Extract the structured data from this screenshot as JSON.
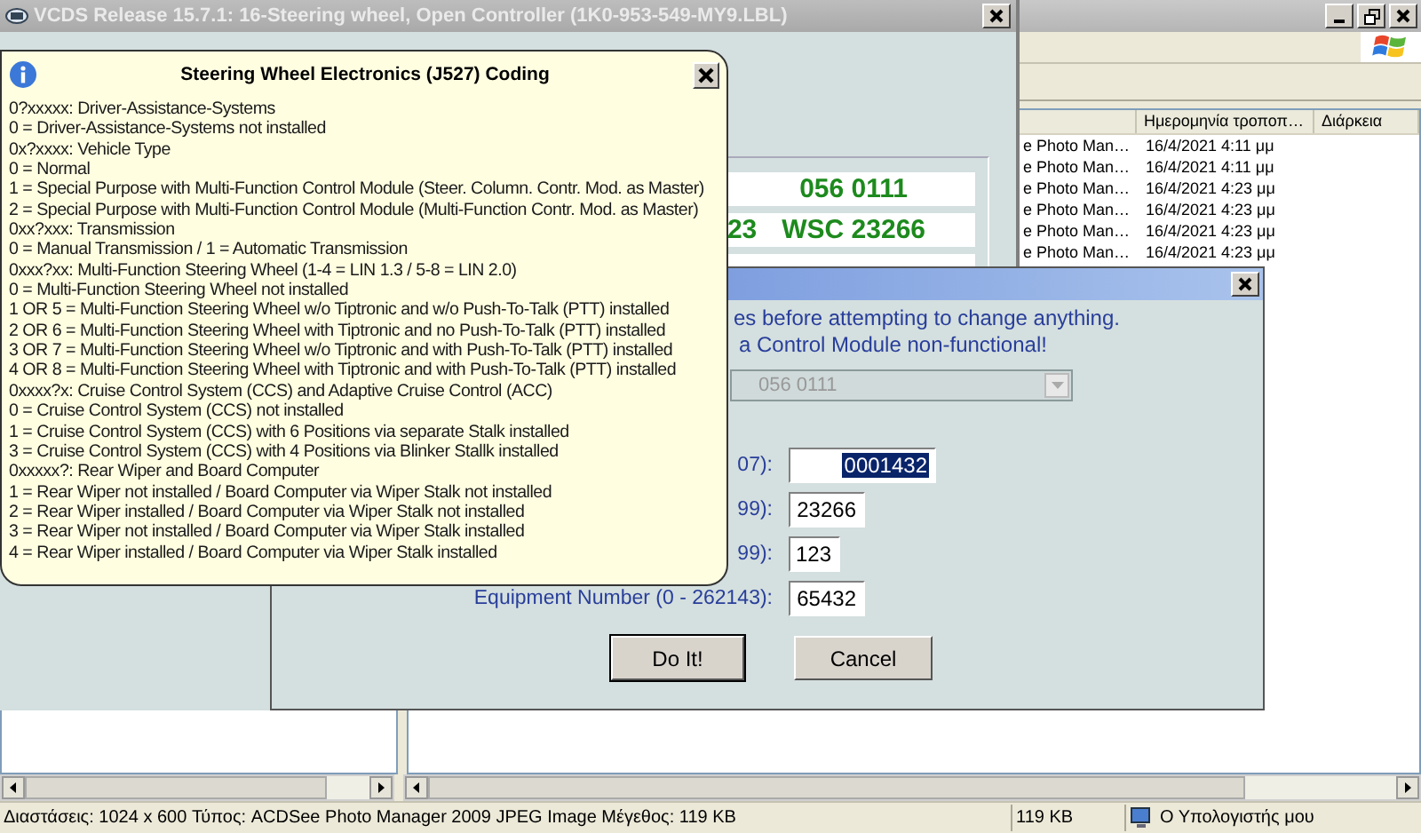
{
  "explorer": {
    "columns": [
      {
        "label": "Ημερομηνία τροποπ…"
      },
      {
        "label": "Διάρκεια"
      }
    ],
    "rows": [
      {
        "name": "e Photo Man…",
        "date": "16/4/2021 4:11 μμ"
      },
      {
        "name": "e Photo Man…",
        "date": "16/4/2021 4:11 μμ"
      },
      {
        "name": "e Photo Man…",
        "date": "16/4/2021 4:23 μμ"
      },
      {
        "name": "e Photo Man…",
        "date": "16/4/2021 4:23 μμ"
      },
      {
        "name": "e Photo Man…",
        "date": "16/4/2021 4:23 μμ"
      },
      {
        "name": "e Photo Man…",
        "date": "16/4/2021 4:23 μμ"
      }
    ],
    "status_bar": {
      "info": "Διαστάσεις: 1024 x 600 Τύπος: ACDSee Photo Manager 2009 JPEG Image Μέγεθος: 119 KB",
      "size": "119 KB",
      "location": "Ο Υπολογιστής μου"
    }
  },
  "vcds_window": {
    "title": "VCDS Release 15.7.1: 16-Steering wheel,  Open Controller (1K0-953-549-MY9.LBL)",
    "readouts": [
      {
        "values": [
          "056 0111"
        ]
      },
      {
        "values": [
          "23",
          "WSC 23266"
        ]
      }
    ]
  },
  "coding_dialog": {
    "messages": [
      "es before attempting to change anything.",
      "a Control Module non-functional!"
    ],
    "dropdown": {
      "value": "056 0111",
      "disabled": true
    },
    "fields": [
      {
        "label": "07):",
        "value": "0001432",
        "selected": true
      },
      {
        "label": "99):",
        "value": "23266",
        "selected": false
      },
      {
        "label": "99):",
        "value": "123",
        "selected": false
      },
      {
        "label": "Equipment Number (0 - 262143):",
        "value": "65432",
        "selected": false
      }
    ],
    "buttons": [
      {
        "label": "Do It!",
        "default": true
      },
      {
        "label": "Cancel",
        "default": false
      }
    ]
  },
  "tooltip": {
    "title": "Steering Wheel Electronics (J527) Coding",
    "lines": [
      "0?xxxxx: Driver-Assistance-Systems",
      "0 = Driver-Assistance-Systems not installed",
      "0x?xxxx: Vehicle Type",
      "0 = Normal",
      "1 = Special Purpose with Multi-Function Control Module (Steer. Column. Contr. Mod. as Master)",
      "2 = Special Purpose with Multi-Function Control Module (Multi-Function Contr. Mod. as Master)",
      "0xx?xxx: Transmission",
      "0 = Manual Transmission / 1 = Automatic Transmission",
      "0xxx?xx: Multi-Function Steering Wheel (1-4 = LIN 1.3 / 5-8 = LIN 2.0)",
      "0 = Multi-Function Steering Wheel not installed",
      "1 OR 5 = Multi-Function Steering Wheel w/o Tiptronic and w/o Push-To-Talk (PTT) installed",
      "2 OR 6 = Multi-Function Steering Wheel with Tiptronic and no Push-To-Talk (PTT) installed",
      "3 OR 7 = Multi-Function Steering Wheel w/o Tiptronic and with Push-To-Talk (PTT) installed",
      "4 OR 8 = Multi-Function Steering Wheel with Tiptronic and with Push-To-Talk (PTT) installed",
      "0xxxx?x: Cruise Control System (CCS) and Adaptive Cruise Control (ACC)",
      "0 = Cruise Control System (CCS) not installed",
      "1 = Cruise Control System (CCS) with 6 Positions via separate Stalk installed",
      "3 = Cruise Control System (CCS) with 4 Positions via Blinker Stallk installed",
      "0xxxxx?: Rear Wiper and Board Computer",
      "1 = Rear Wiper not installed / Board Computer via Wiper Stalk not installed",
      "2 = Rear Wiper installed / Board Computer via Wiper Stalk not installed",
      "3 = Rear Wiper not installed / Board Computer via Wiper Stalk installed",
      "4 = Rear Wiper installed / Board Computer via Wiper Stalk installed"
    ]
  }
}
